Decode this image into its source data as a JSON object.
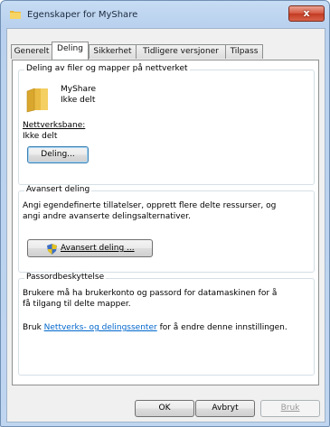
{
  "window": {
    "title": "Egenskaper for MyShare",
    "close_symbol": "x",
    "icon": "folder-icon",
    "accent": "#c7dcf4"
  },
  "tabs": [
    {
      "label": "Generelt",
      "active": false
    },
    {
      "label": "Deling",
      "active": true
    },
    {
      "label": "Sikkerhet",
      "active": false
    },
    {
      "label": "Tidligere versjoner",
      "active": false
    },
    {
      "label": "Tilpass",
      "active": false
    }
  ],
  "sharing": {
    "group_title": "Deling av filer og mapper på nettverket",
    "folder_name": "MyShare",
    "folder_status": "Ikke delt",
    "path_label": "Nettverksbane:",
    "path_value": "Ikke delt",
    "share_button": "Deling..."
  },
  "advanced": {
    "group_title": "Avansert deling",
    "description_line1": "Angi egendefinerte tillatelser, opprett flere delte ressurser, og",
    "description_line2": "angi andre avanserte delingsalternativer.",
    "button": "Avansert deling ...",
    "button_icon": "shield-icon"
  },
  "password": {
    "group_title": "Passordbeskyttelse",
    "description_line1": "Brukere må ha brukerkonto og passord for datamaskinen for å",
    "description_line2": "få tilgang til delte mapper.",
    "hint_prefix": "Bruk ",
    "hint_link": "Nettverks- og delingssenter",
    "hint_suffix": " for å endre denne innstillingen."
  },
  "footer": {
    "ok": "OK",
    "cancel": "Avbryt",
    "apply": "Bruk"
  }
}
